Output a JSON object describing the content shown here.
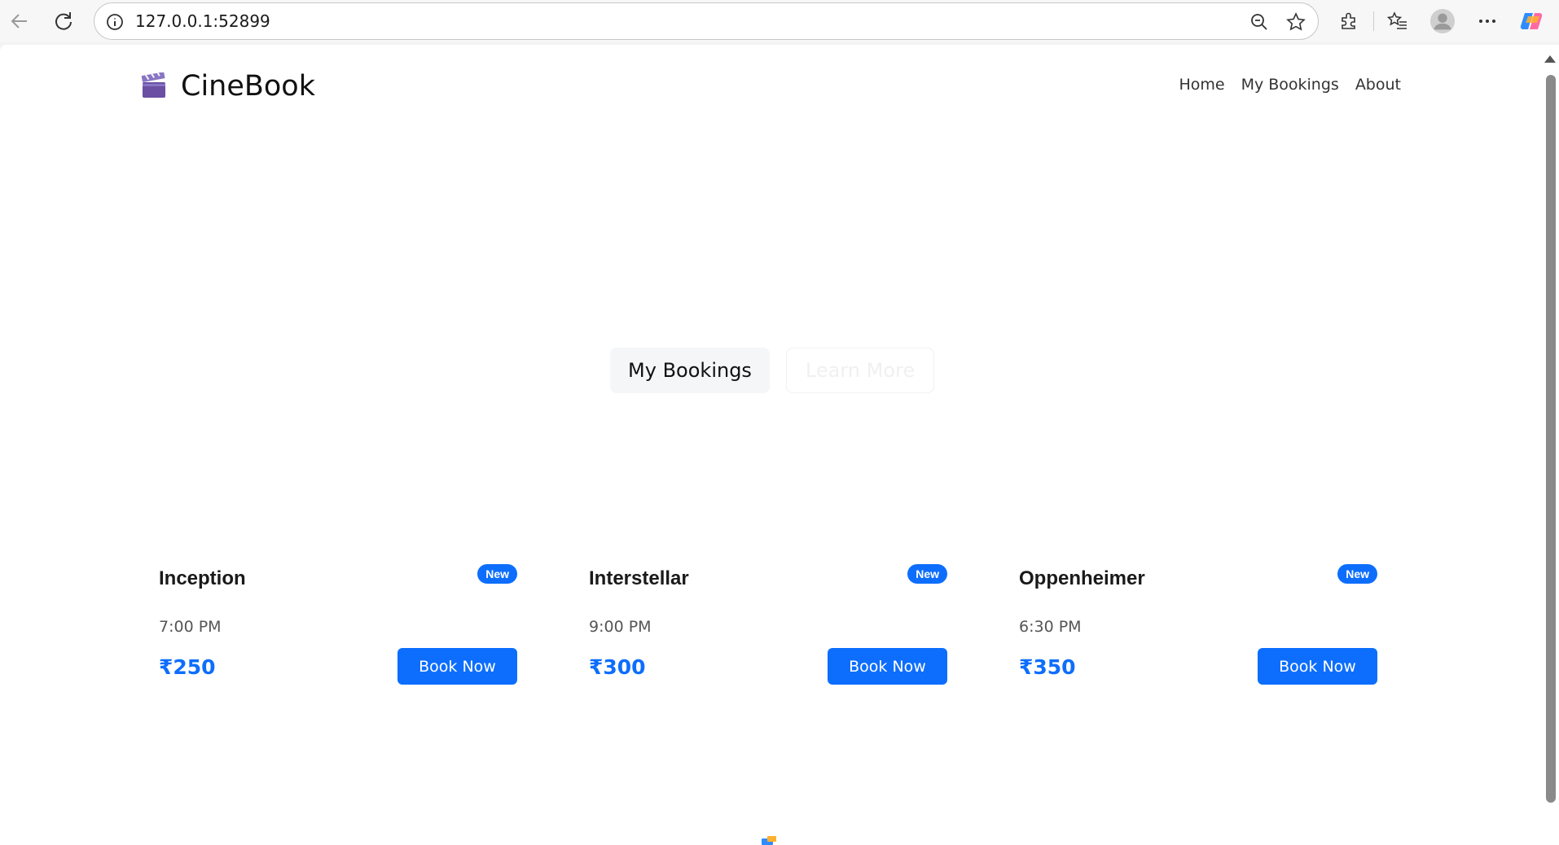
{
  "browser": {
    "url": "127.0.0.1:52899"
  },
  "site": {
    "brand": "CineBook",
    "nav": [
      "Home",
      "My Bookings",
      "About"
    ]
  },
  "hero": {
    "primary_button": "My Bookings",
    "secondary_button": "Learn More"
  },
  "movies": [
    {
      "title": "Inception",
      "badge": "New",
      "time": "7:00 PM",
      "price": "₹250",
      "button": "Book Now"
    },
    {
      "title": "Interstellar",
      "badge": "New",
      "time": "9:00 PM",
      "price": "₹300",
      "button": "Book Now"
    },
    {
      "title": "Oppenheimer",
      "badge": "New",
      "time": "6:30 PM",
      "price": "₹350",
      "button": "Book Now"
    }
  ],
  "colors": {
    "accent": "#0d6efd",
    "page_bg": "#ffffff",
    "chrome_bg": "#f7f7f7"
  }
}
